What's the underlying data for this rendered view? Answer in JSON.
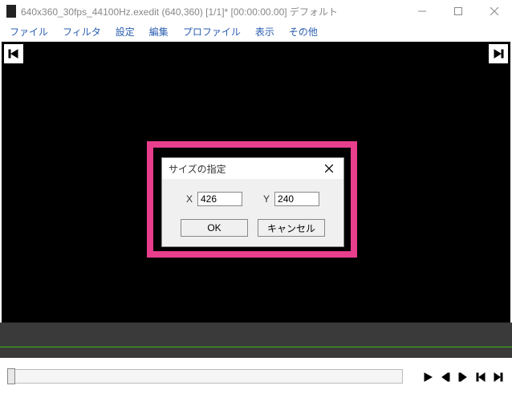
{
  "titlebar": {
    "text": "640x360_30fps_44100Hz.exedit (640,360)  [1/1]* [00:00:00.00]  デフォルト"
  },
  "menu": {
    "file": "ファイル",
    "filter": "フィルタ",
    "settings": "設定",
    "edit": "編集",
    "profile": "プロファイル",
    "view": "表示",
    "other": "その他"
  },
  "dialog": {
    "title": "サイズの指定",
    "x_label": "X",
    "x_value": "426",
    "y_label": "Y",
    "y_value": "240",
    "ok": "OK",
    "cancel": "キャンセル"
  }
}
